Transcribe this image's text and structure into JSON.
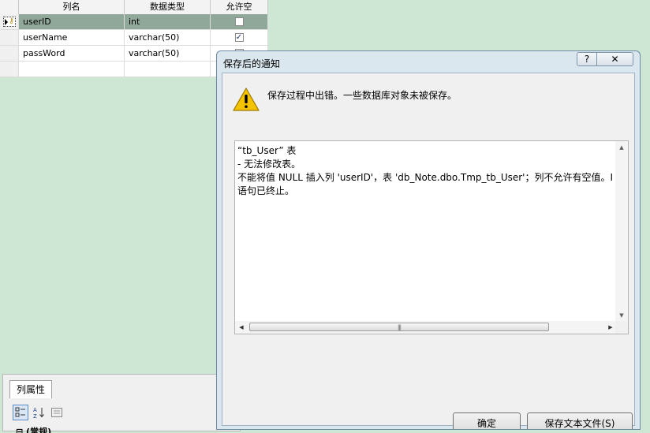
{
  "grid": {
    "headers": [
      "列名",
      "数据类型",
      "允许空"
    ],
    "rows": [
      {
        "name": "userID",
        "type": "int",
        "allow_null": false,
        "selected": true,
        "primary_key": true
      },
      {
        "name": "userName",
        "type": "varchar(50)",
        "allow_null": true,
        "selected": false,
        "primary_key": false
      },
      {
        "name": "passWord",
        "type": "varchar(50)",
        "allow_null": true,
        "selected": false,
        "primary_key": false
      },
      {
        "name": "",
        "type": "",
        "allow_null": false,
        "selected": false,
        "primary_key": false
      }
    ]
  },
  "properties": {
    "tab_label": "列属性",
    "first_group": "(常规)"
  },
  "dialog": {
    "title": "保存后的通知",
    "help_glyph": "?",
    "close_glyph": "✕",
    "message": "保存过程中出错。一些数据库对象未被保存。",
    "details": {
      "line1": "“tb_User” 表",
      "line2": "- 无法修改表。",
      "line3": "不能将值 NULL 插入列 'userID'，表 'db_Note.dbo.Tmp_tb_User'；列不允许有空值。I",
      "line4": "语句已终止。"
    },
    "ok_label": "确定",
    "save_text_label": "保存文本文件(S)"
  },
  "colors": {
    "background": "#cde7d4",
    "selected_row": "#8fa89a",
    "dialog_frame": "#dbe7ef",
    "warning": "#f5c400"
  }
}
